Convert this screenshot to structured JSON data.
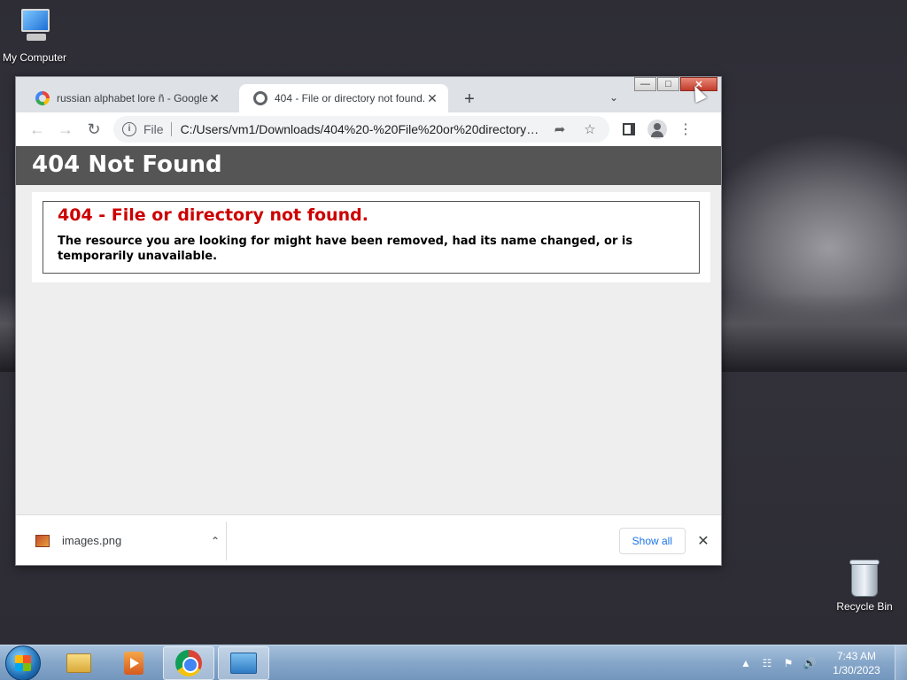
{
  "desktop": {
    "icons": [
      {
        "label": "My Computer"
      },
      {
        "label": "Recycle Bin"
      }
    ]
  },
  "browser": {
    "tabs": [
      {
        "title": "russian alphabet lore ñ - Google",
        "icon": "google-icon"
      },
      {
        "title": "404 - File or directory not found.",
        "icon": "globe-icon"
      }
    ],
    "new_tab_label": "+",
    "address": {
      "scheme": "File",
      "url": "C:/Users/vm1/Downloads/404%20-%20File%20or%20directory%20n..."
    },
    "page": {
      "header": "404 Not Found",
      "error_title": "404 - File or directory not found.",
      "error_text": "The resource you are looking for might have been removed, had its name changed, or is temporarily unavailable."
    },
    "downloads": {
      "file_name": "images.png",
      "show_all_label": "Show all"
    }
  },
  "taskbar": {
    "clock_time": "7:43 AM",
    "clock_date": "1/30/2023"
  }
}
